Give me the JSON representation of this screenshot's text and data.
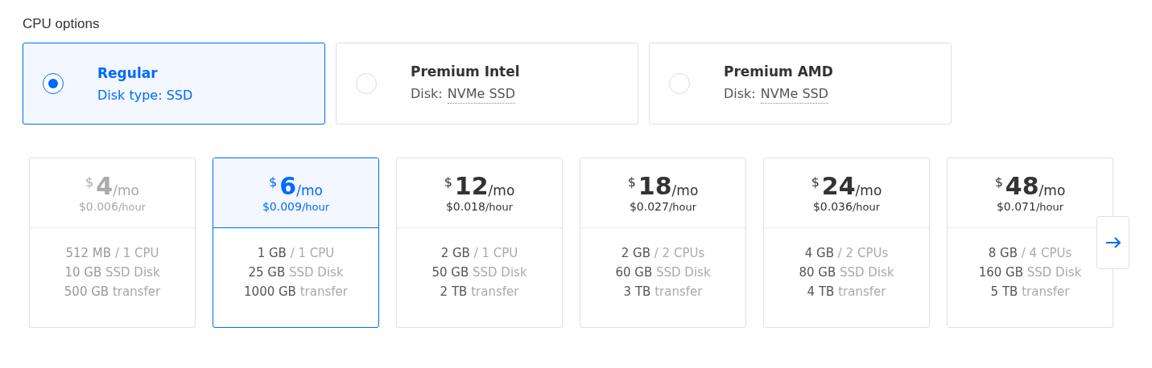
{
  "section_title": "CPU options",
  "cpu_options": [
    {
      "name": "Regular",
      "disk_label": "Disk type: SSD",
      "selected": true
    },
    {
      "name": "Premium Intel",
      "disk_label": "Disk:",
      "disk_value": "NVMe SSD",
      "selected": false
    },
    {
      "name": "Premium AMD",
      "disk_label": "Disk:",
      "disk_value": "NVMe SSD",
      "selected": false
    }
  ],
  "plans": [
    {
      "currency": "$",
      "price": "4",
      "period": "/mo",
      "hourly": "$0.006",
      "hourly_unit": "/hour",
      "selected": false,
      "disabled": true,
      "specs": [
        {
          "amount": "512 MB",
          "label": "/ 1 CPU"
        },
        {
          "amount": "10 GB",
          "label": "SSD Disk"
        },
        {
          "amount": "500 GB",
          "label": "transfer"
        }
      ]
    },
    {
      "currency": "$",
      "price": "6",
      "period": "/mo",
      "hourly": "$0.009",
      "hourly_unit": "/hour",
      "selected": true,
      "disabled": false,
      "specs": [
        {
          "amount": "1 GB",
          "label": "/ 1 CPU"
        },
        {
          "amount": "25 GB",
          "label": "SSD Disk"
        },
        {
          "amount": "1000 GB",
          "label": "transfer"
        }
      ]
    },
    {
      "currency": "$",
      "price": "12",
      "period": "/mo",
      "hourly": "$0.018",
      "hourly_unit": "/hour",
      "selected": false,
      "disabled": false,
      "specs": [
        {
          "amount": "2 GB",
          "label": "/ 1 CPU"
        },
        {
          "amount": "50 GB",
          "label": "SSD Disk"
        },
        {
          "amount": "2 TB",
          "label": "transfer"
        }
      ]
    },
    {
      "currency": "$",
      "price": "18",
      "period": "/mo",
      "hourly": "$0.027",
      "hourly_unit": "/hour",
      "selected": false,
      "disabled": false,
      "specs": [
        {
          "amount": "2 GB",
          "label": "/ 2 CPUs"
        },
        {
          "amount": "60 GB",
          "label": "SSD Disk"
        },
        {
          "amount": "3 TB",
          "label": "transfer"
        }
      ]
    },
    {
      "currency": "$",
      "price": "24",
      "period": "/mo",
      "hourly": "$0.036",
      "hourly_unit": "/hour",
      "selected": false,
      "disabled": false,
      "specs": [
        {
          "amount": "4 GB",
          "label": "/ 2 CPUs"
        },
        {
          "amount": "80 GB",
          "label": "SSD Disk"
        },
        {
          "amount": "4 TB",
          "label": "transfer"
        }
      ]
    },
    {
      "currency": "$",
      "price": "48",
      "period": "/mo",
      "hourly": "$0.071",
      "hourly_unit": "/hour",
      "selected": false,
      "disabled": false,
      "specs": [
        {
          "amount": "8 GB",
          "label": "/ 4 CPUs"
        },
        {
          "amount": "160 GB",
          "label": "SSD Disk"
        },
        {
          "amount": "5 TB",
          "label": "transfer"
        }
      ]
    }
  ]
}
